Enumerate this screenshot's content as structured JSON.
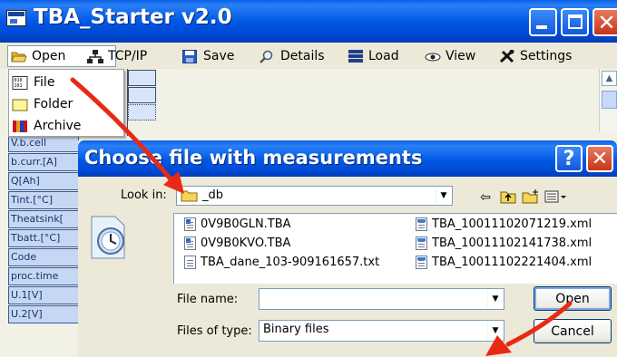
{
  "window": {
    "title": "TBA_Starter v2.0",
    "menu": [
      {
        "label": "Open",
        "icon": "open-folder-icon"
      },
      {
        "label": "TCP/IP",
        "icon": "network-icon"
      },
      {
        "label": "Save",
        "icon": "floppy-disk-icon"
      },
      {
        "label": "Details",
        "icon": "magnifier-icon"
      },
      {
        "label": "Load",
        "icon": "list-icon"
      },
      {
        "label": "View",
        "icon": "eye-icon"
      },
      {
        "label": "Settings",
        "icon": "tools-icon"
      }
    ]
  },
  "open_menu": {
    "items": [
      {
        "label": "File",
        "icon": "binary-file-icon"
      },
      {
        "label": "Folder",
        "icon": "folder-icon"
      },
      {
        "label": "Archive",
        "icon": "archive-icon"
      }
    ]
  },
  "side_cells": [
    "V.b.cell",
    "b.curr.[A]",
    "Q[Ah]",
    "Tint.[°C]",
    "Theatsink[",
    "Tbatt.[°C]",
    "Code",
    "proc.time",
    "U.1[V]",
    "U.2[V]"
  ],
  "dialog": {
    "title": "Choose file with measurements",
    "help_label": "?",
    "look_in_label": "Look in:",
    "look_in_value": "_db",
    "files_left": [
      {
        "name": "0V9B0GLN.TBA",
        "icon": "tba-file-icon"
      },
      {
        "name": "0V9B0KVO.TBA",
        "icon": "tba-file-icon"
      },
      {
        "name": "TBA_dane_103-909161657.txt",
        "icon": "text-file-icon"
      }
    ],
    "files_right": [
      {
        "name": "TBA_10011102071219.xml",
        "icon": "xml-file-icon"
      },
      {
        "name": "TBA_10011102141738.xml",
        "icon": "xml-file-icon"
      },
      {
        "name": "TBA_10011102221404.xml",
        "icon": "xml-file-icon"
      }
    ],
    "file_name_label": "File name:",
    "file_name_value": "",
    "files_of_type_label": "Files of type:",
    "files_of_type_value": "Binary files",
    "open_button": "Open",
    "cancel_button": "Cancel"
  },
  "colors": {
    "titlebar": "#0058E6",
    "annotation_arrow": "#E82A14",
    "face": "#ECE9D8"
  }
}
